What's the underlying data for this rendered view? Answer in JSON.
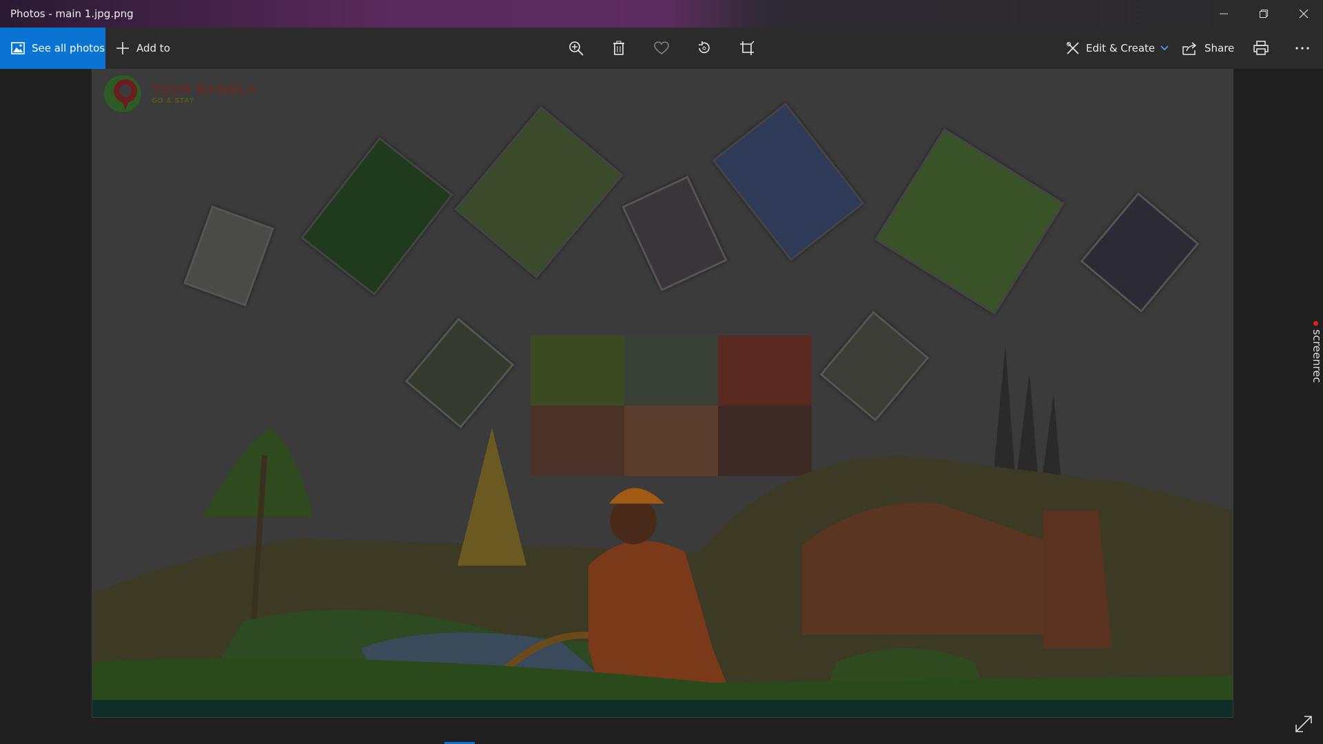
{
  "window": {
    "title": "Photos - main 1.jpg.png"
  },
  "toolbar": {
    "see_all_label": "See all photos",
    "add_to_label": "Add to",
    "edit_create_label": "Edit & Create",
    "share_label": "Share"
  },
  "image": {
    "logo_title": "TOUR BANGLA",
    "logo_tagline": "GO & STAY"
  },
  "watermark": {
    "text": "screenrec"
  },
  "colors": {
    "accent": "#0a74d4",
    "toolbar_bg": "#2b2b2b",
    "stage_bg": "#202020"
  },
  "icons": [
    "photos-icon",
    "plus-icon",
    "zoom-in-icon",
    "delete-icon",
    "heart-icon",
    "rotate-icon",
    "crop-icon",
    "edit-create-icon",
    "chevron-down-icon",
    "share-icon",
    "print-icon",
    "more-icon",
    "minimize-icon",
    "maximize-icon",
    "close-icon",
    "fullscreen-icon"
  ]
}
